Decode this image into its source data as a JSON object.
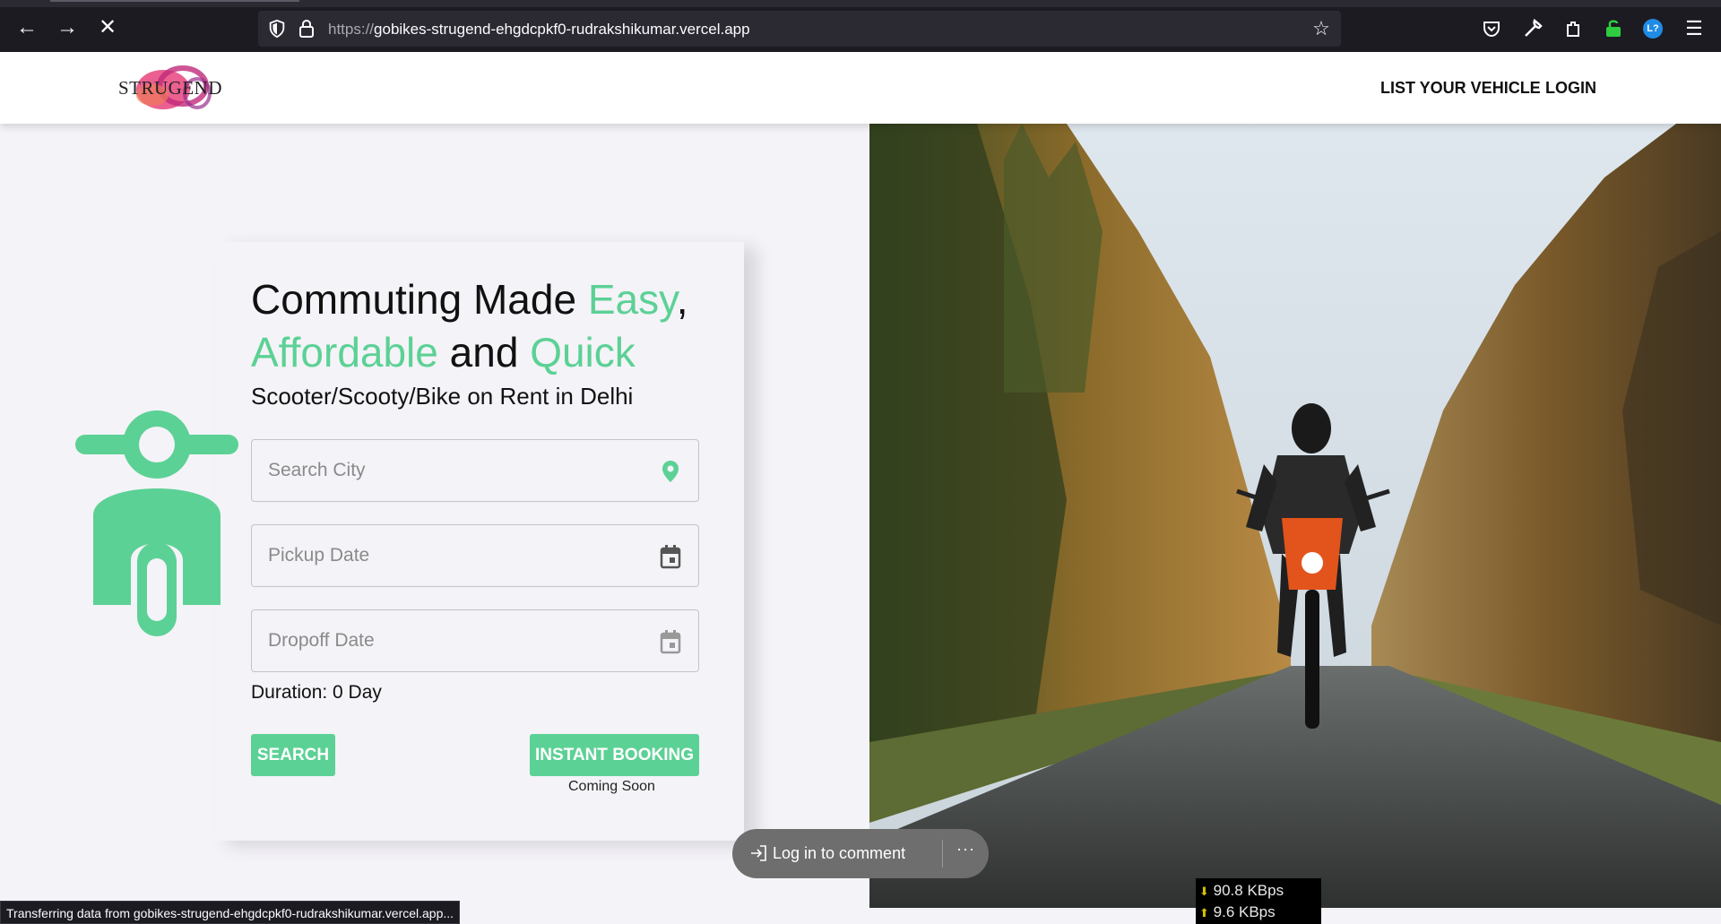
{
  "browser": {
    "url_protocol": "https://",
    "url_host": "gobikes-strugend-ehgdcpkf0-rudrakshikumar.vercel.app",
    "status_text": "Transferring data from gobikes-strugend-ehgdcpkf0-rudrakshikumar.vercel.app...",
    "download_speed": "90.8 KBps",
    "upload_speed": "9.6 KBps",
    "extension_badge": "L?"
  },
  "header": {
    "logo_text": "STRUGEND",
    "nav": {
      "list_vehicle": "LIST YOUR VEHICLE",
      "login": "LOGIN"
    }
  },
  "hero": {
    "headline": {
      "part1": "Commuting Made ",
      "accent1": "Easy",
      "part2": ",",
      "accent2": "Affordable",
      "part3": " and ",
      "accent3": "Quick"
    },
    "subline": "Scooter/Scooty/Bike on Rent in Delhi"
  },
  "form": {
    "city_placeholder": "Search City",
    "pickup_placeholder": "Pickup Date",
    "dropoff_placeholder": "Dropoff Date",
    "duration": "Duration: 0 Day",
    "search_label": "SEARCH",
    "instant_label": "INSTANT BOOKING",
    "instant_note": "Coming Soon"
  },
  "comment": {
    "label": "Log in to comment",
    "more": "···"
  },
  "colors": {
    "accent": "#5cd195",
    "page_bg": "#f4f3f8"
  }
}
